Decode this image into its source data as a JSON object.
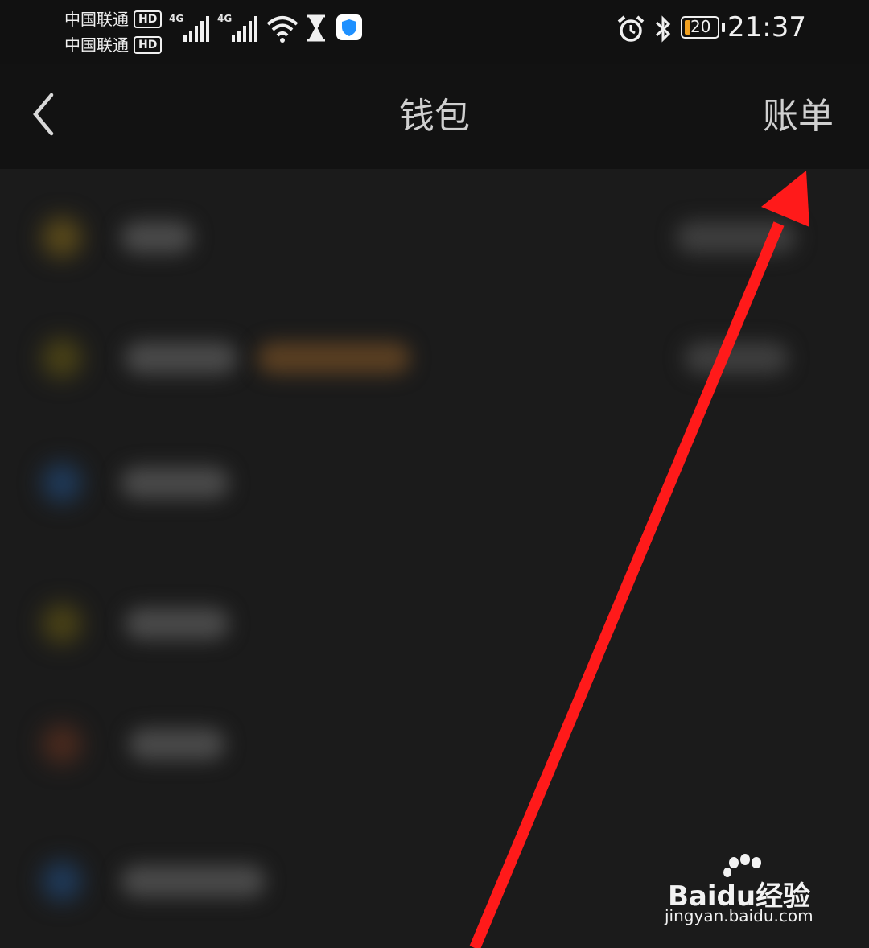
{
  "status_bar": {
    "carrier1": "中国联通",
    "carrier2": "中国联通",
    "hd_badge": "HD",
    "net1": "4G",
    "net2": "4G",
    "battery_level": "20",
    "time": "21:37",
    "icons": [
      "hourglass-icon",
      "shield-app-icon",
      "alarm-icon",
      "bluetooth-icon",
      "wifi-icon"
    ]
  },
  "navbar": {
    "back_icon": "chevron-left-icon",
    "title": "钱包",
    "bills": "账单"
  },
  "annotation": {
    "arrow_color": "#ff1a1a"
  },
  "watermark": {
    "brand": "Bai",
    "brand2": "du",
    "product": "经验",
    "url": "jingyan.baidu.com"
  },
  "list_rows": [
    {
      "dot_color": "#5a4a1a"
    },
    {
      "dot_color": "#5a4a1a"
    },
    {
      "dot_color": "#1f3a5a"
    },
    {
      "dot_color": "#4a4216"
    },
    {
      "dot_color": "#4a2a1e"
    },
    {
      "dot_color": "#1f3a5a"
    }
  ]
}
